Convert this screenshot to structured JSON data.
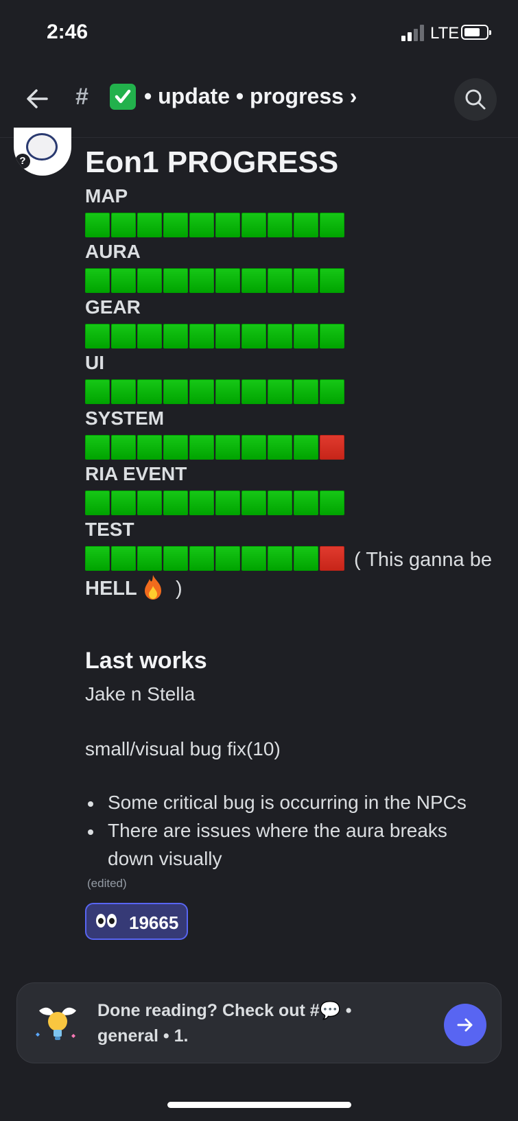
{
  "status_bar": {
    "time": "2:46",
    "carrier": "LTE"
  },
  "header": {
    "hash": "#",
    "channel_title": "• update • progress ›"
  },
  "message": {
    "title": "Eon1 PROGRESS",
    "progress": [
      {
        "label": "MAP",
        "done": 10,
        "total": 10
      },
      {
        "label": "AURA",
        "done": 10,
        "total": 10
      },
      {
        "label": "GEAR",
        "done": 10,
        "total": 10
      },
      {
        "label": "UI",
        "done": 10,
        "total": 10
      },
      {
        "label": "SYSTEM",
        "done": 9,
        "total": 10
      },
      {
        "label": "RIA EVENT",
        "done": 10,
        "total": 10
      },
      {
        "label": "TEST",
        "done": 9,
        "total": 10
      }
    ],
    "test_note": "( This ganna be",
    "hell": "HELL",
    "hell_close": ")",
    "last_works_heading": "Last works",
    "line1": "Jake n Stella",
    "line2": "small/visual bug fix(10)",
    "bullets": [
      "Some critical bug is occurring in the NPCs",
      "There are issues where the aura breaks",
      "down visually"
    ],
    "edited": "(edited)"
  },
  "reaction": {
    "count": "19665"
  },
  "banner": {
    "text_line1": "Done reading? Check out #💬 •",
    "text_line2": "general • 1."
  },
  "colors": {
    "accent": "#5865f2",
    "green": "#16c716",
    "red": "#e03a2e"
  }
}
